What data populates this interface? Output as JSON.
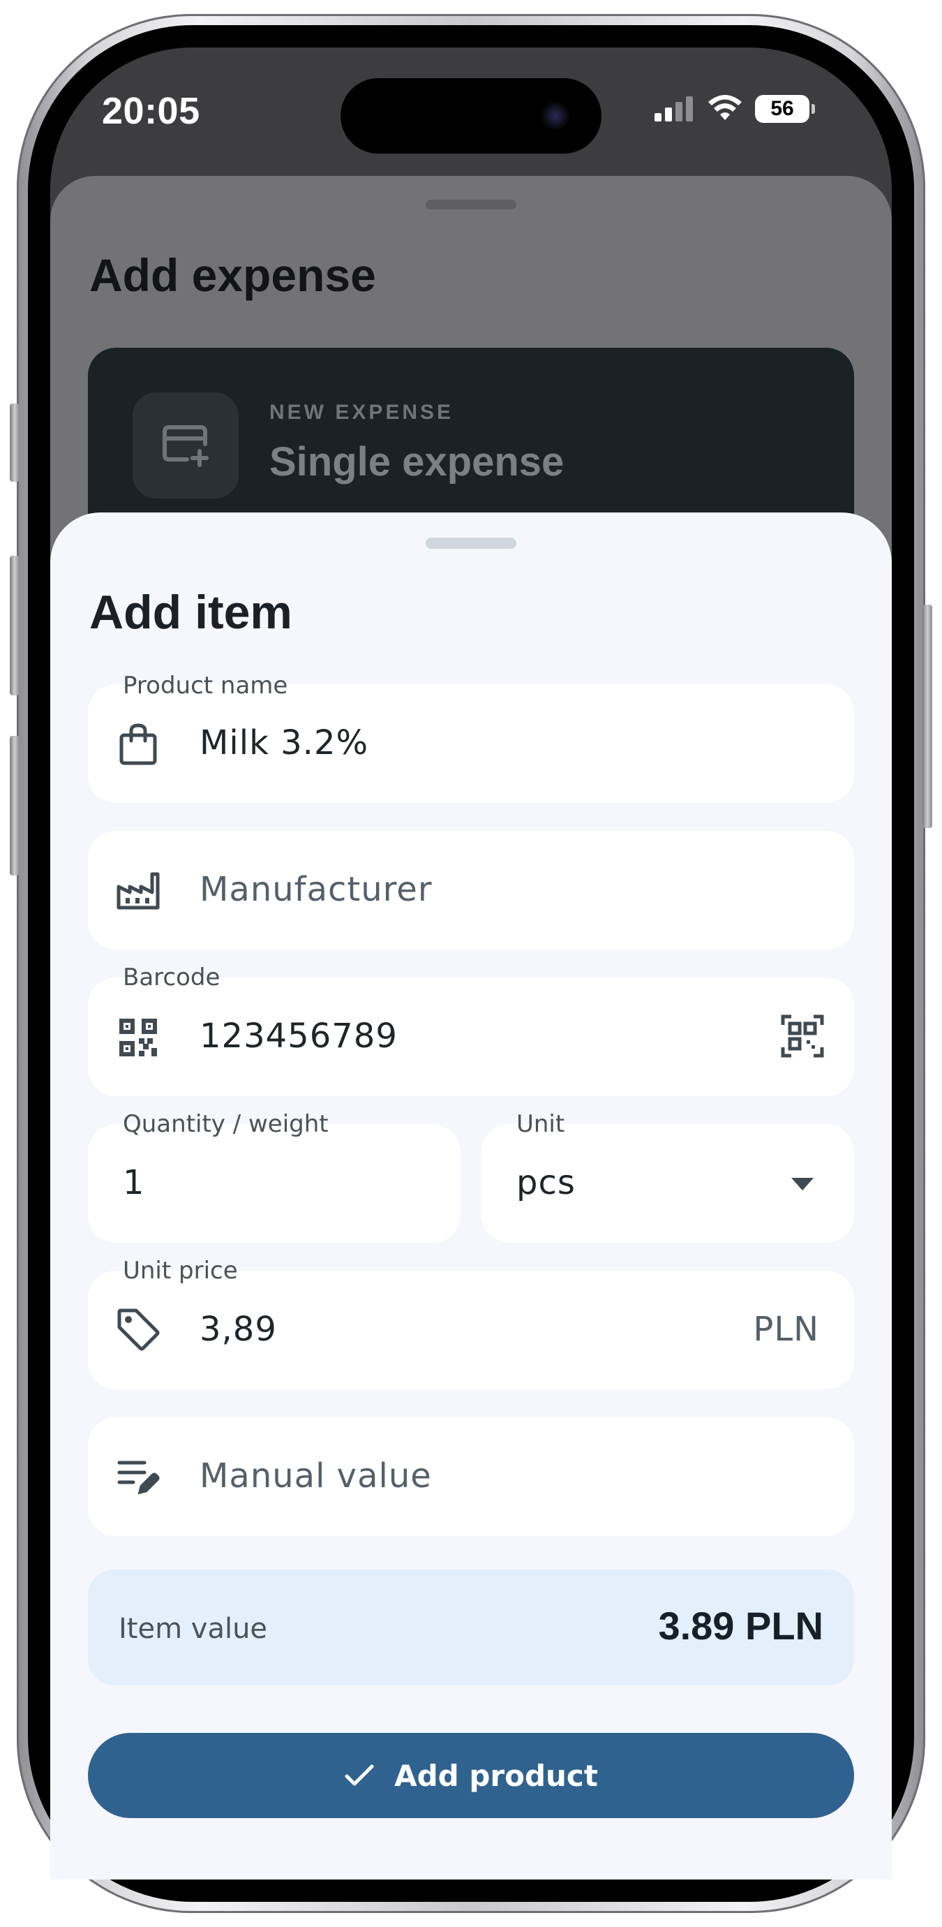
{
  "status_bar": {
    "time": "20:05",
    "battery": "56"
  },
  "background_sheet": {
    "title": "Add expense",
    "card": {
      "kicker": "NEW EXPENSE",
      "title": "Single expense",
      "icon": "card-add-icon"
    }
  },
  "sheet": {
    "title": "Add item",
    "product_name": {
      "label": "Product name",
      "value": "Milk 3.2%",
      "icon": "shopping-bag-icon"
    },
    "manufacturer": {
      "placeholder": "Manufacturer",
      "icon": "factory-icon"
    },
    "barcode": {
      "label": "Barcode",
      "value": "123456789",
      "icon": "qr-code-icon",
      "action_icon": "qr-scan-icon"
    },
    "quantity": {
      "label": "Quantity / weight",
      "value": "1"
    },
    "unit": {
      "label": "Unit",
      "value": "pcs",
      "icon": "dropdown-arrow-icon"
    },
    "unit_price": {
      "label": "Unit price",
      "value": "3,89",
      "currency": "PLN",
      "icon": "price-tag-icon"
    },
    "manual_value": {
      "placeholder": "Manual value",
      "icon": "edit-list-icon"
    },
    "item_value": {
      "label": "Item value",
      "amount": "3.89 PLN"
    },
    "add_button": {
      "label": "Add product",
      "icon": "check-icon"
    }
  },
  "colors": {
    "accent": "#2f628f",
    "sheet_background": "#f5f7fc",
    "item_value_background": "#e3effb",
    "field_background": "#ffffff"
  }
}
